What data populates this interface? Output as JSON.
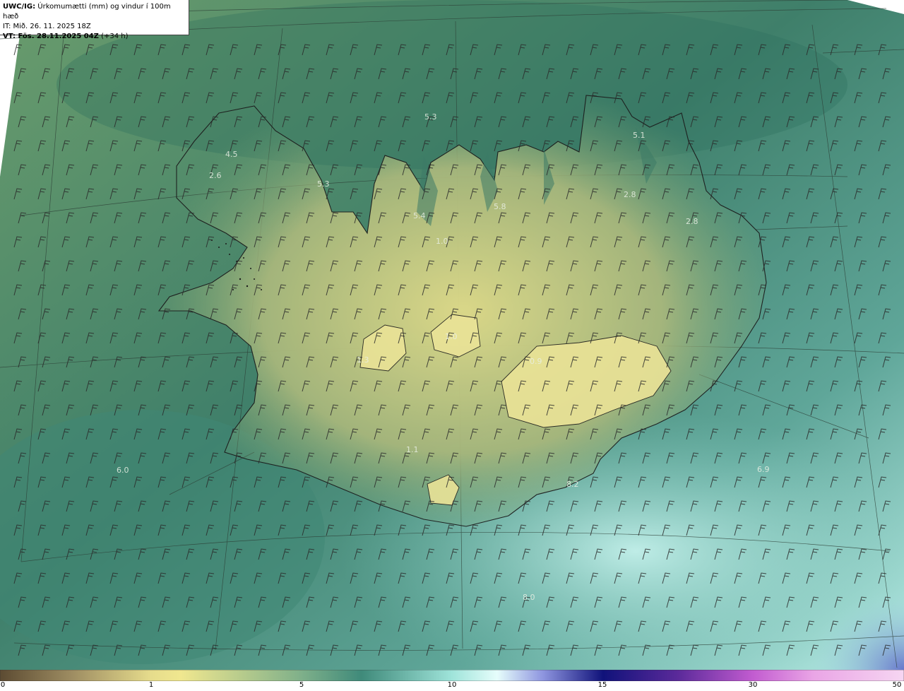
{
  "header": {
    "model": "UWC/IG:",
    "title": "Úrkomumætti (mm) og vindur í 100m hæð",
    "initial_time": "IT: Mið. 26. 11. 2025 18Z",
    "valid_prefix": "VT: Fös. 28.11.2025 04Z",
    "valid_offset": "(+34 h)"
  },
  "map": {
    "value_labels": [
      {
        "id": "n1",
        "text": "5.3"
      },
      {
        "id": "n2",
        "text": "5.1"
      },
      {
        "id": "n3",
        "text": "4.5"
      },
      {
        "id": "n4",
        "text": "2.6"
      },
      {
        "id": "n5",
        "text": "5.3"
      },
      {
        "id": "n6",
        "text": "5.4"
      },
      {
        "id": "n7",
        "text": "5.8"
      },
      {
        "id": "n8",
        "text": "2.8"
      },
      {
        "id": "n9",
        "text": "2.8"
      },
      {
        "id": "n10",
        "text": "1.0"
      },
      {
        "id": "n11",
        "text": "1.0"
      },
      {
        "id": "n12",
        "text": "1.3"
      },
      {
        "id": "n13",
        "text": "0.9"
      },
      {
        "id": "n14",
        "text": "6.0"
      },
      {
        "id": "n15",
        "text": "1.1"
      },
      {
        "id": "n16",
        "text": "8.2"
      },
      {
        "id": "n17",
        "text": "6.9"
      },
      {
        "id": "n18",
        "text": "8.0"
      }
    ],
    "color_stops": [
      "#6b5a3e",
      "#b9a575",
      "#e8e08e",
      "#8fb98a",
      "#4f9184",
      "#9ee0d8",
      "#d8fbf8",
      "#5a5ecb",
      "#1b1a8a",
      "#7a2fa8",
      "#d36ad9",
      "#f0a8e8"
    ]
  },
  "colorbar": {
    "ticks": [
      "0",
      "1",
      "5",
      "10",
      "15",
      "30",
      "50"
    ]
  }
}
